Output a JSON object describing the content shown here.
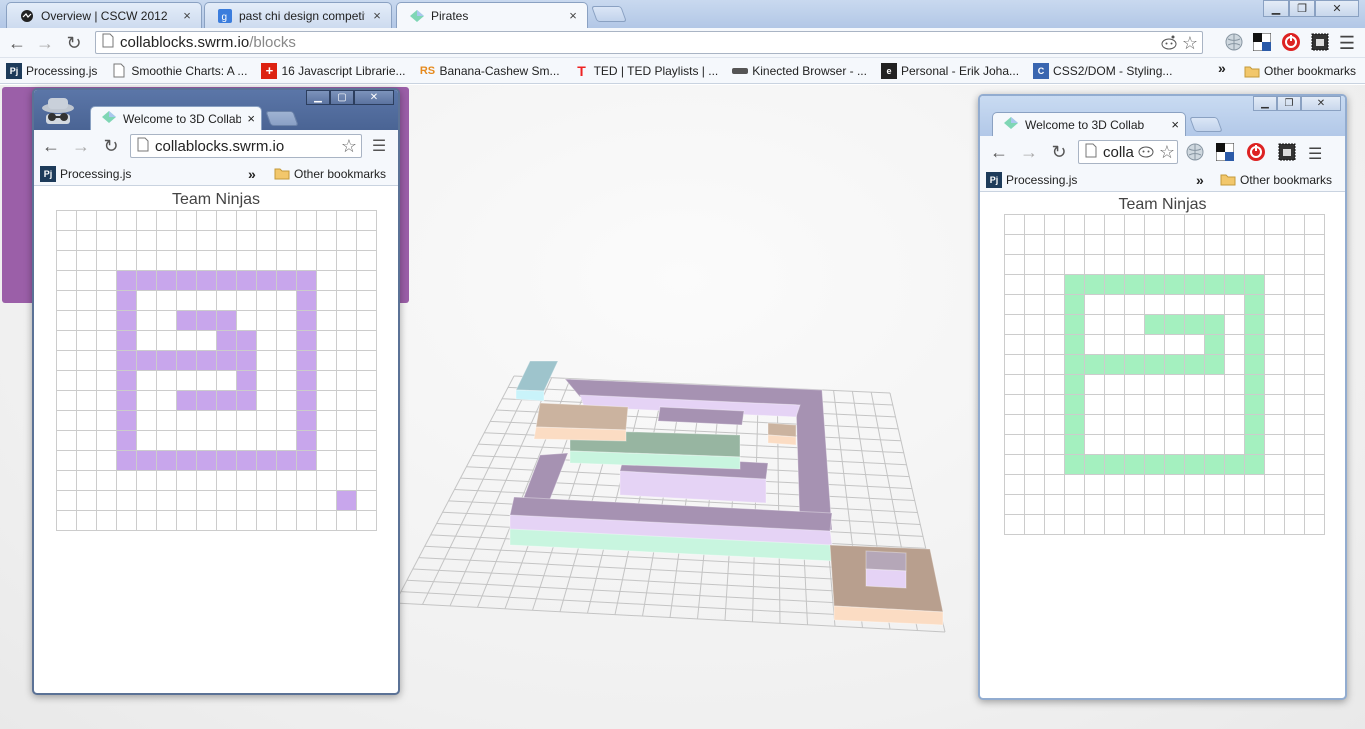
{
  "browser": {
    "tabs": [
      {
        "label": "Overview | CSCW 2012",
        "icon": "cscw-icon",
        "active": false
      },
      {
        "label": "past chi design competitio",
        "icon": "google-icon",
        "active": false
      },
      {
        "label": "Pirates",
        "icon": "collablocks-icon",
        "active": true
      }
    ],
    "url_host": "collablocks.swrm.io",
    "url_path": "/blocks",
    "bookmarks": [
      {
        "label": "Processing.js",
        "icon": "processing-icon"
      },
      {
        "label": "Smoothie Charts: A ...",
        "icon": "page-icon"
      },
      {
        "label": "16 Javascript Librarie...",
        "icon": "red-plus-icon"
      },
      {
        "label": "Banana-Cashew Sm...",
        "icon": "rs-icon"
      },
      {
        "label": "TED | TED Playlists | ...",
        "icon": "ted-icon"
      },
      {
        "label": "Kinected Browser - ...",
        "icon": "kinect-icon"
      },
      {
        "label": "Personal - Erik Joha...",
        "icon": "evernote-icon"
      },
      {
        "label": "CSS2/DOM - Styling...",
        "icon": "css-icon"
      }
    ],
    "overflow": "»",
    "other_bookmarks": "Other bookmarks"
  },
  "left_popup": {
    "tab_label": "Welcome to 3D Collab",
    "url": "collablocks.swrm.io",
    "bookmark": "Processing.js",
    "overflow": "»",
    "other_bookmarks": "Other bookmarks",
    "team": "Team Ninjas",
    "fill_color": "#c8a6ec",
    "rows": 16,
    "cols": 16,
    "filled": [
      "................",
      "................",
      "................",
      "...XXXXXXXXXX...",
      "...X........X...",
      "...X..XXX...X...",
      "...X....XX..X...",
      "...XXXXXXX..X...",
      "...X.....X..X...",
      "...X..XXXX..X...",
      "...X........X...",
      "...X........X...",
      "...XXXXXXXXXX...",
      "................",
      "..............X.",
      "................"
    ]
  },
  "right_popup": {
    "tab_label": "Welcome to 3D Collab",
    "url": "colla",
    "bookmark": "Processing.js",
    "overflow": "»",
    "other_bookmarks": "Other bookmarks",
    "team": "Team Ninjas",
    "fill_color": "#a4f0bf",
    "rows": 16,
    "cols": 16,
    "filled": [
      "................",
      "................",
      "................",
      "...XXXXXXXXXX...",
      "...X........X...",
      "...X...XXXX.X...",
      "...X......X.X...",
      "...XXXXXXXX.X...",
      "...X........X...",
      "...X........X...",
      "...X........X...",
      "...X........X...",
      "...XXXXXXXXXX...",
      "................",
      "................",
      "................"
    ]
  }
}
